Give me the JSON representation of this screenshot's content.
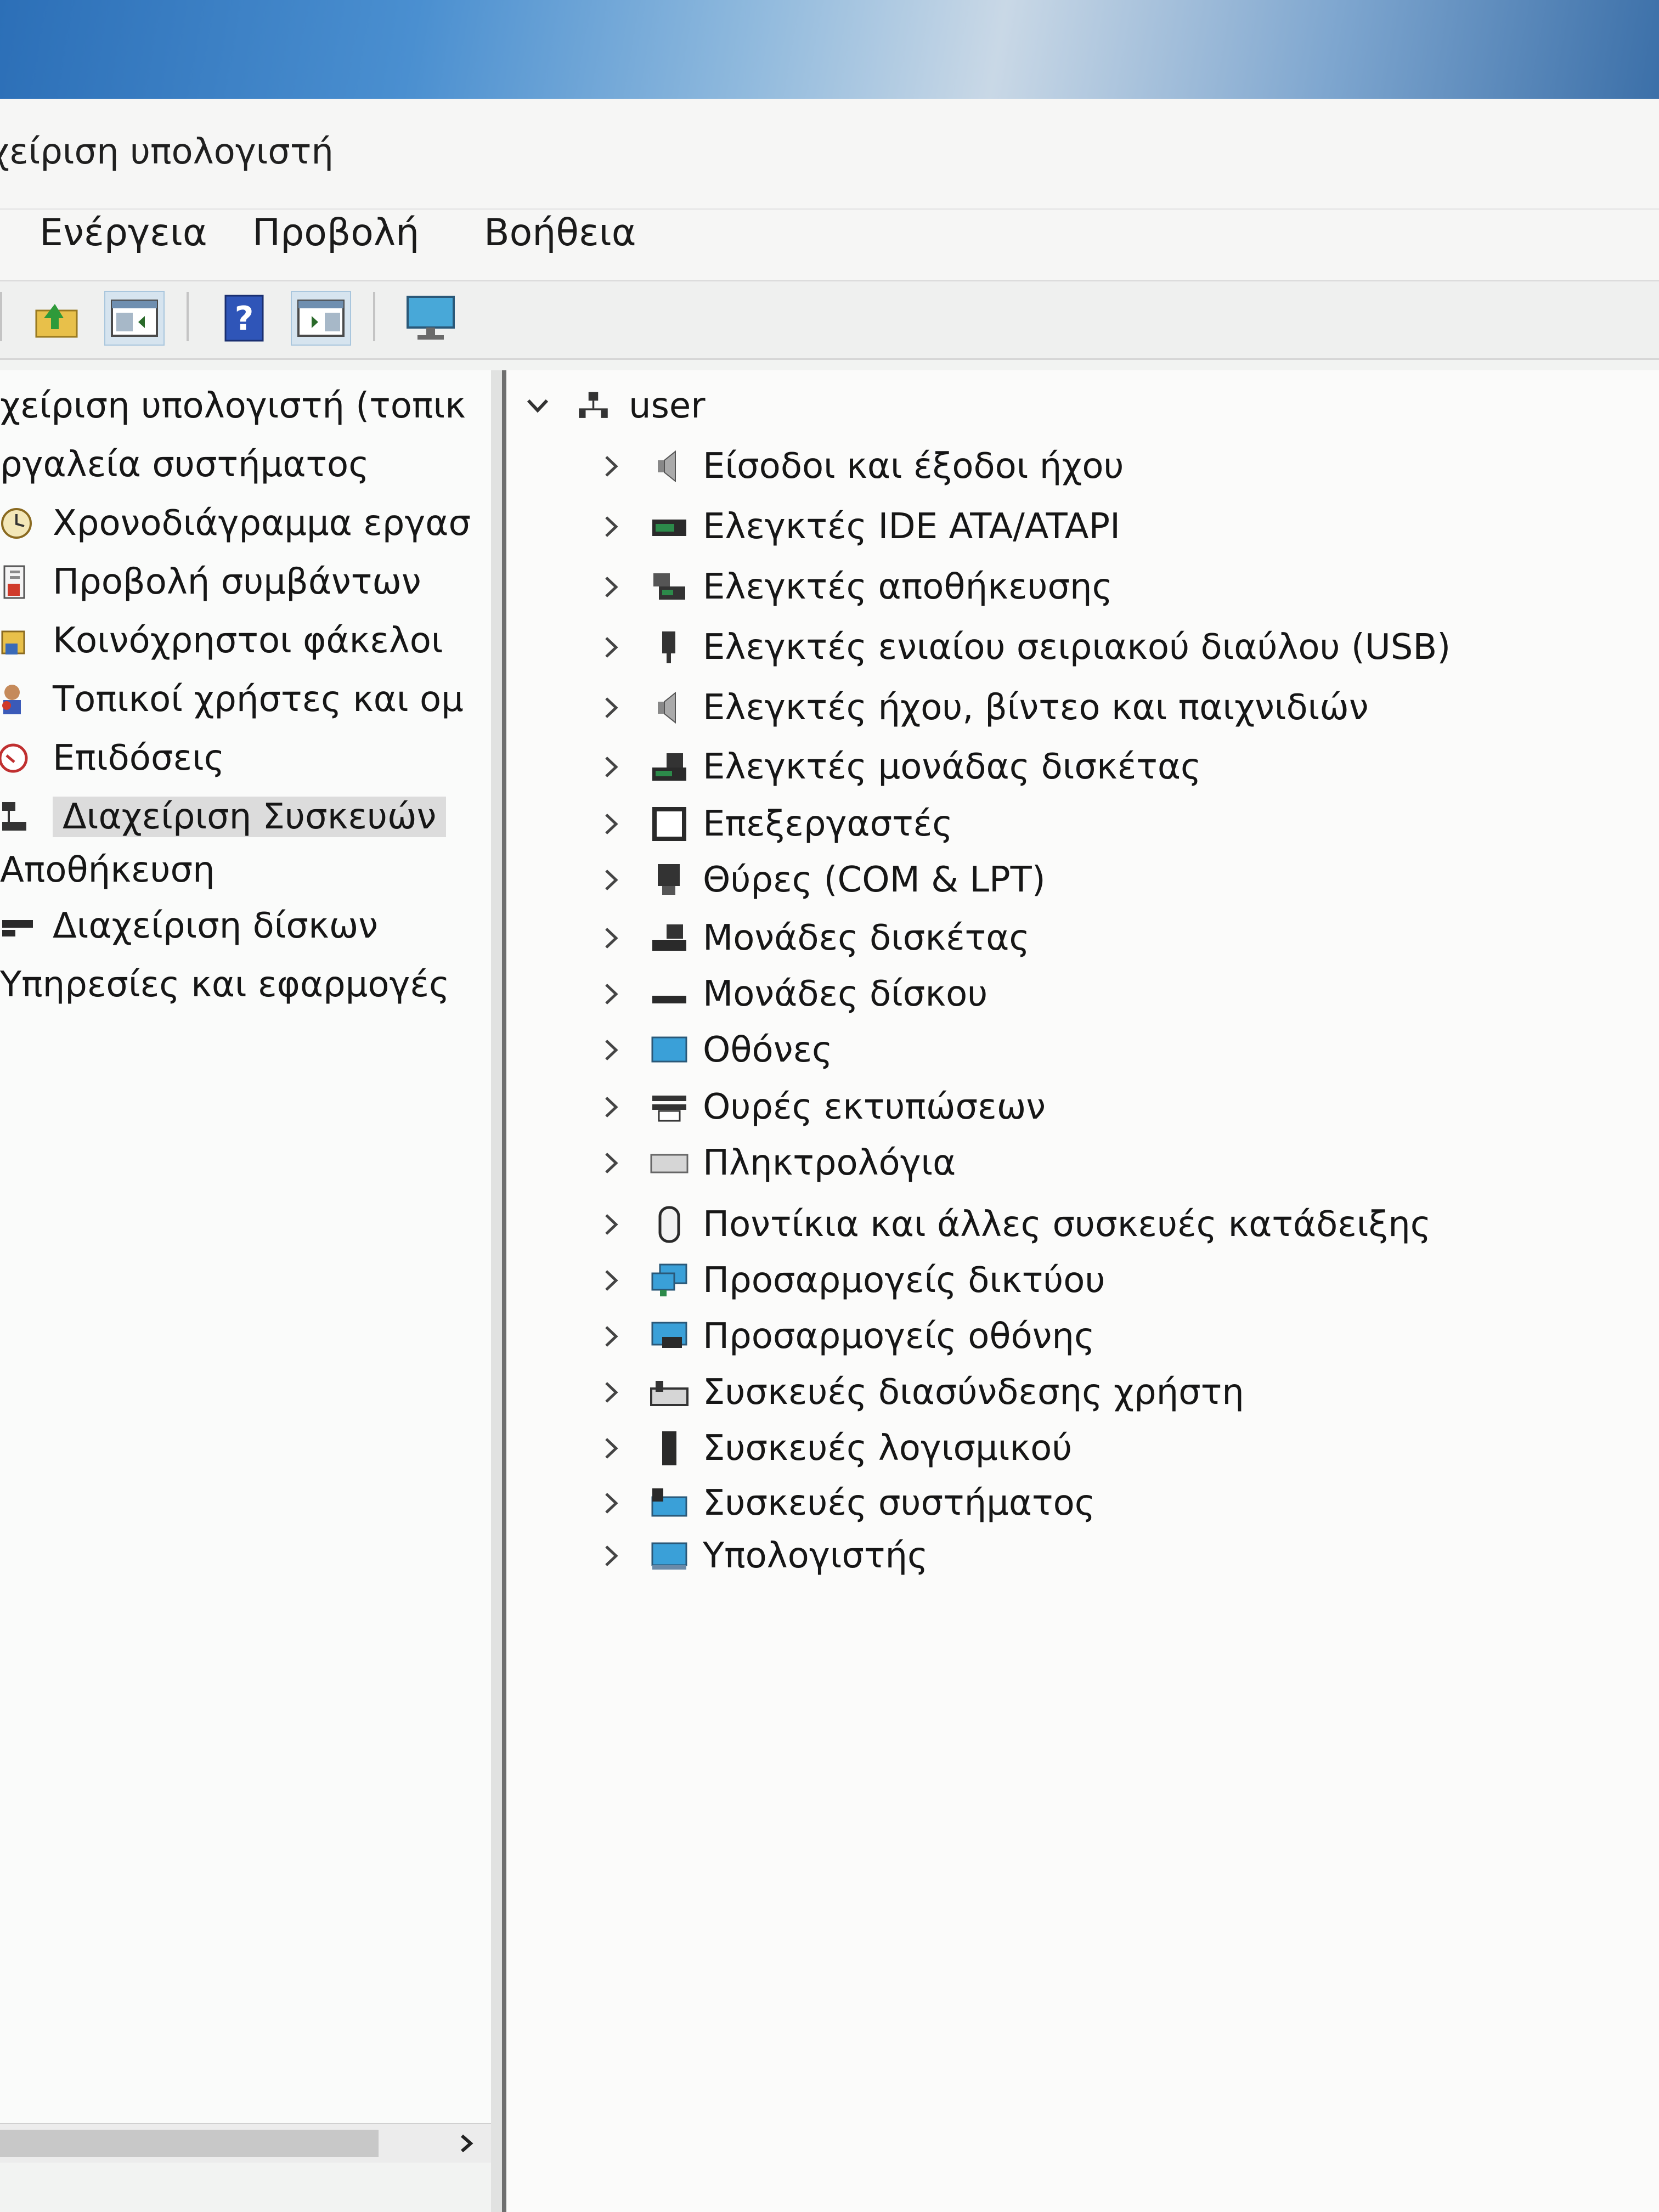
{
  "window": {
    "title": "χείριση υπολογιστή"
  },
  "menu": [
    "Ενέργεια",
    "Προβολή",
    "Βοήθεια"
  ],
  "toolbar": [
    {
      "icon": "up-folder-icon"
    },
    {
      "icon": "show-hide-console-tree-icon"
    },
    {
      "icon": "help-icon"
    },
    {
      "icon": "show-hide-action-pane-icon"
    },
    {
      "icon": "monitor-icon"
    }
  ],
  "left_tree": [
    {
      "label": "χείριση υπολογιστή (τοπικ",
      "icon": "computer-management-icon",
      "level": 0
    },
    {
      "label": "ργαλεία συστήματος",
      "icon": "tools-icon",
      "level": 0
    },
    {
      "label": "Χρονοδιάγραμμα εργασ",
      "icon": "task-scheduler-icon",
      "level": 1
    },
    {
      "label": "Προβολή συμβάντων",
      "icon": "event-viewer-icon",
      "level": 1
    },
    {
      "label": "Κοινόχρηστοι φάκελοι",
      "icon": "shared-folders-icon",
      "level": 1
    },
    {
      "label": "Τοπικοί χρήστες και ομ",
      "icon": "local-users-icon",
      "level": 1
    },
    {
      "label": "Επιδόσεις",
      "icon": "performance-icon",
      "level": 1
    },
    {
      "label": "Διαχείριση Συσκευών",
      "icon": "device-manager-icon",
      "level": 1,
      "selected": true
    },
    {
      "label": "Αποθήκευση",
      "icon": "storage-icon",
      "level": 0
    },
    {
      "label": "Διαχείριση δίσκων",
      "icon": "disk-management-icon",
      "level": 1
    },
    {
      "label": "Υπηρεσίες και εφαρμογές",
      "icon": "services-icon",
      "level": 0
    }
  ],
  "device_tree": {
    "root": {
      "label": "user",
      "icon": "computer-network-icon"
    },
    "categories": [
      {
        "label": "Είσοδοι και έξοδοι ήχου",
        "icon": "speaker-icon"
      },
      {
        "label": "Ελεγκτές IDE ATA/ATAPI",
        "icon": "ide-controller-icon"
      },
      {
        "label": "Ελεγκτές αποθήκευσης",
        "icon": "storage-controller-icon"
      },
      {
        "label": "Ελεγκτές ενιαίου σειριακού διαύλου (USB)",
        "icon": "usb-icon"
      },
      {
        "label": "Ελεγκτές ήχου, βίντεο και παιχνιδιών",
        "icon": "audio-video-icon"
      },
      {
        "label": "Ελεγκτές μονάδας δισκέτας",
        "icon": "floppy-controller-icon"
      },
      {
        "label": "Επεξεργαστές",
        "icon": "processor-icon"
      },
      {
        "label": "Θύρες (COM & LPT)",
        "icon": "port-icon"
      },
      {
        "label": "Μονάδες δισκέτας",
        "icon": "floppy-drive-icon"
      },
      {
        "label": "Μονάδες δίσκου",
        "icon": "disk-drive-icon"
      },
      {
        "label": "Οθόνες",
        "icon": "monitor-icon"
      },
      {
        "label": "Ουρές εκτυπώσεων",
        "icon": "printer-icon"
      },
      {
        "label": "Πληκτρολόγια",
        "icon": "keyboard-icon"
      },
      {
        "label": "Ποντίκια και άλλες συσκευές κατάδειξης",
        "icon": "mouse-icon"
      },
      {
        "label": "Προσαρμογείς δικτύου",
        "icon": "network-adapter-icon"
      },
      {
        "label": "Προσαρμογείς οθόνης",
        "icon": "display-adapter-icon"
      },
      {
        "label": "Συσκευές διασύνδεσης χρήστη",
        "icon": "hid-icon"
      },
      {
        "label": "Συσκευές λογισμικού",
        "icon": "software-device-icon"
      },
      {
        "label": "Συσκευές συστήματος",
        "icon": "system-device-icon"
      },
      {
        "label": "Υπολογιστής",
        "icon": "computer-icon"
      }
    ]
  }
}
